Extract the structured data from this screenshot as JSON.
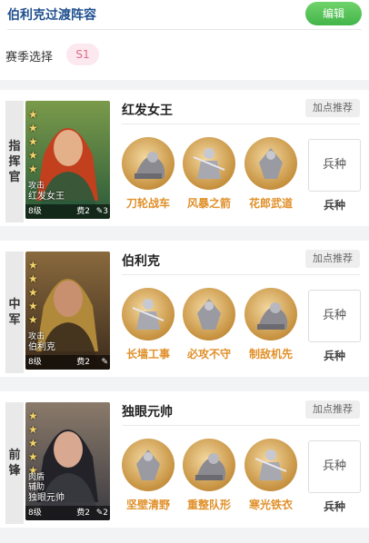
{
  "header": {
    "title": "伯利克过渡阵容",
    "edit_label": "编辑"
  },
  "season": {
    "label": "赛季选择",
    "value": "S1"
  },
  "recommend_label": "加点推荐",
  "troop_box_label": "兵种",
  "troop_label": "兵种",
  "cards": [
    {
      "position": [
        "指",
        "挥",
        "官"
      ],
      "name": "红发女王",
      "portrait": {
        "tags": [
          "攻击"
        ],
        "name": "红发女王",
        "level": "8级",
        "cost": "费2",
        "faction_value": "3",
        "stars": 5
      },
      "skills": [
        "刀轮战车",
        "风暴之箭",
        "花郎武道"
      ],
      "colors": {
        "bg1": "#2b5a3a",
        "bg2": "#7a9a4a",
        "hair": "#c2401e",
        "skin": "#e3b08a"
      }
    },
    {
      "position": [
        "中",
        "军"
      ],
      "name": "伯利克",
      "portrait": {
        "tags": [
          "攻击"
        ],
        "name": "伯利克",
        "level": "8级",
        "cost": "费2",
        "faction_value": "",
        "stars": 5
      },
      "skills": [
        "长墙工事",
        "必攻不守",
        "制敌机先"
      ],
      "colors": {
        "bg1": "#3b2b1c",
        "bg2": "#8a6a3e",
        "hair": "#b08a3a",
        "skin": "#c99070"
      }
    },
    {
      "position": [
        "前",
        "锋"
      ],
      "name": "独眼元帅",
      "portrait": {
        "tags": [
          "肉盾",
          "辅助"
        ],
        "name": "独眼元帅",
        "level": "8级",
        "cost": "费2",
        "faction_value": "2",
        "stars": 5
      },
      "skills": [
        "坚壁清野",
        "重整队形",
        "寒光铁衣"
      ],
      "colors": {
        "bg1": "#3a3a40",
        "bg2": "#8a7a6a",
        "hair": "#222228",
        "skin": "#d8a890"
      }
    }
  ]
}
